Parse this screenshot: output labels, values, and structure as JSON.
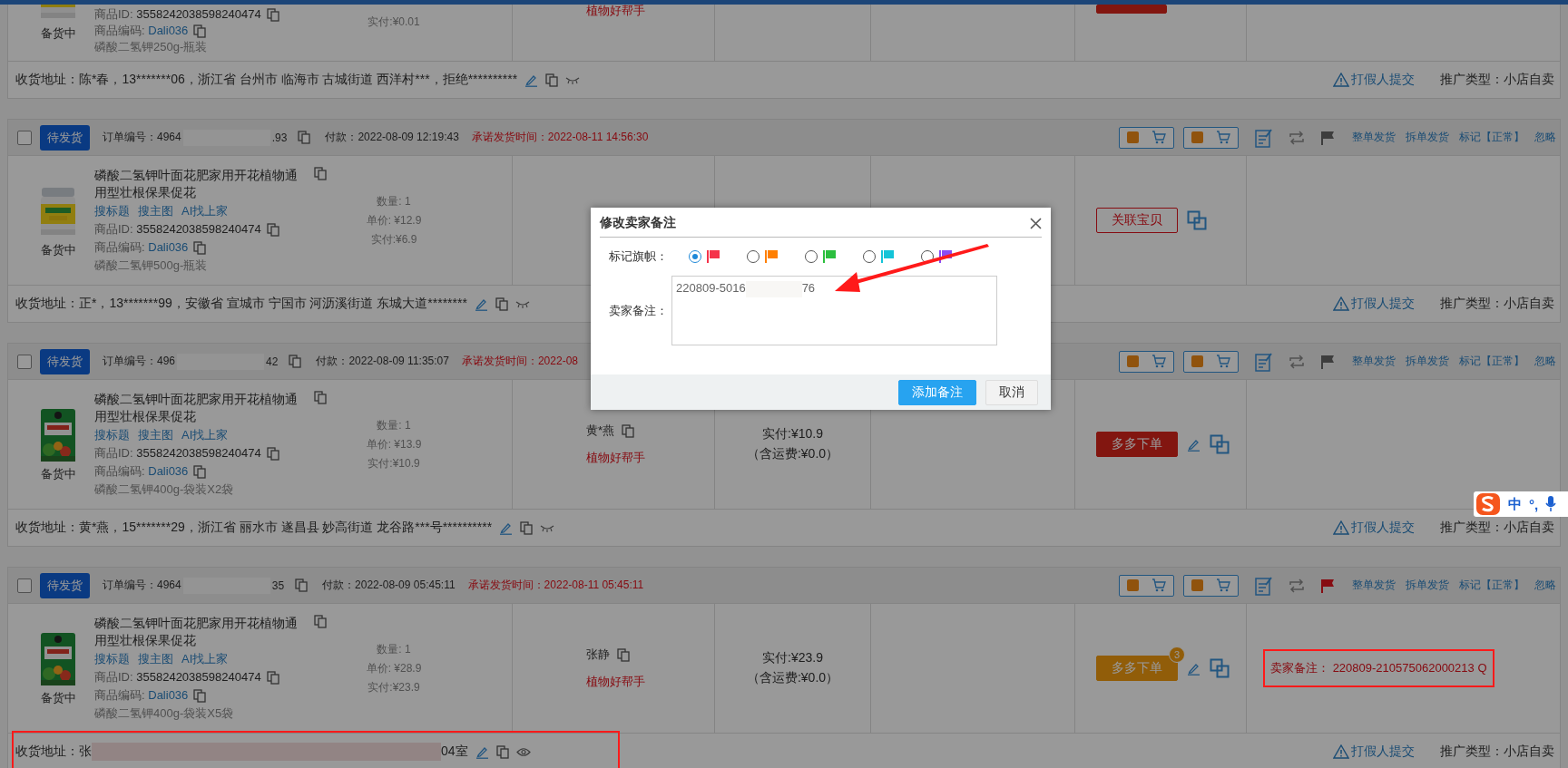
{
  "orders": [
    {
      "cut": true,
      "product": {
        "id_label": "商品ID:",
        "id": "3558242038598240474",
        "code_label": "商品编码:",
        "code": "Dali036",
        "spec": "磷酸二氢钾250g-瓶装",
        "stock": "备货中"
      },
      "qty": {
        "paid": "实付:¥0.01"
      },
      "buyer": {
        "store": "植物好帮手"
      },
      "action": {
        "kind": "red"
      },
      "address": {
        "parts": [
          "收货地址：陈*春，13*******06，浙江省 台州市 临海市 古城街道 西洋村***，拒绝**********"
        ],
        "masked": true,
        "highlight": false
      },
      "report": "打假人提交",
      "promo": "推广类型：小店自卖"
    },
    {
      "header": {
        "checked": false,
        "status": "待发货",
        "order_no": [
          "订单编号：4964",
          ".93"
        ],
        "payment": "付款：2022-08-09 12:19:43",
        "deadline": "承诺发货时间：2022-08-11 14:56:30",
        "flagged": false,
        "links": [
          "整单发货",
          "拆单发货",
          "标记【正常】",
          "忽略"
        ]
      },
      "product": {
        "title": "磷酸二氢钾叶面花肥家用开花植物通用型壮根保果促花",
        "search_links": [
          "搜标题",
          "搜主图",
          "AI找上家"
        ],
        "id_label": "商品ID:",
        "id": "3558242038598240474",
        "code_label": "商品编码:",
        "code": "Dali036",
        "spec": "磷酸二氢钾500g-瓶装",
        "stock": "备货中"
      },
      "qty": {
        "count": "数量: 1",
        "unit": "单价: ¥12.9",
        "paid": "实付:¥6.9"
      },
      "action": {
        "kind": "outline",
        "label": "关联宝贝",
        "edit": false
      },
      "address": {
        "parts": [
          "收货地址：正*，13*******99，安徽省 宣城市 宁国市 河沥溪街道 东城大道********"
        ],
        "masked": true,
        "highlight": false
      },
      "report": "打假人提交",
      "promo": "推广类型：小店自卖"
    },
    {
      "header": {
        "checked": false,
        "status": "待发货",
        "order_no": [
          "订单编号：496",
          "42"
        ],
        "payment": "付款：2022-08-09 11:35:07",
        "deadline": "承诺发货时间：2022-08",
        "flagged": false,
        "links": [
          "整单发货",
          "拆单发货",
          "标记【正常】",
          "忽略"
        ]
      },
      "product": {
        "title": "磷酸二氢钾叶面花肥家用开花植物通用型壮根保果促花",
        "search_links": [
          "搜标题",
          "搜主图",
          "AI找上家"
        ],
        "id_label": "商品ID:",
        "id": "3558242038598240474",
        "code_label": "商品编码:",
        "code": "Dali036",
        "spec": "磷酸二氢钾400g-袋装X2袋",
        "stock": "备货中"
      },
      "qty": {
        "count": "数量: 1",
        "unit": "单价: ¥13.9",
        "paid": "实付:¥10.9"
      },
      "buyer": {
        "name": "黄*燕",
        "store": "植物好帮手"
      },
      "amount": {
        "paid": "实付:¥10.9",
        "shipping": "（含运费:¥0.0）"
      },
      "action": {
        "kind": "red",
        "label": "多多下单",
        "edit": true
      },
      "address": {
        "parts": [
          "收货地址：黄*燕，15*******29，浙江省 丽水市 遂昌县 妙高街道 龙谷路***号**********"
        ],
        "masked": true,
        "highlight": false
      },
      "report": "打假人提交",
      "promo": "推广类型：小店自卖"
    },
    {
      "header": {
        "checked": false,
        "status": "待发货",
        "order_no": [
          "订单编号：4964",
          "35"
        ],
        "payment": "付款：2022-08-09 05:45:11",
        "deadline": "承诺发货时间：2022-08-11 05:45:11",
        "flagged": true,
        "links": [
          "整单发货",
          "拆单发货",
          "标记【正常】",
          "忽略"
        ]
      },
      "product": {
        "title": "磷酸二氢钾叶面花肥家用开花植物通用型壮根保果促花",
        "search_links": [
          "搜标题",
          "搜主图",
          "AI找上家"
        ],
        "id_label": "商品ID:",
        "id": "3558242038598240474",
        "code_label": "商品编码:",
        "code": "Dali036",
        "spec": "磷酸二氢钾400g-袋装X5袋",
        "stock": "备货中"
      },
      "qty": {
        "count": "数量: 1",
        "unit": "单价: ¥28.9",
        "paid": "实付:¥23.9"
      },
      "buyer": {
        "name": "张静",
        "store": "植物好帮手"
      },
      "amount": {
        "paid": "实付:¥23.9",
        "shipping": "（含运费:¥0.0）"
      },
      "action": {
        "kind": "orange",
        "label": "多多下单",
        "badge": "3",
        "edit": true
      },
      "remark": {
        "label": "卖家备注：",
        "value": "220809-210575062000213 Q",
        "highlight": true
      },
      "address": {
        "parts": [
          "收货地址：张",
          "04室"
        ],
        "masked": false,
        "highlight": true
      },
      "report": "打假人提交",
      "promo": "推广类型：小店自卖"
    }
  ],
  "modal": {
    "title": "修改卖家备注",
    "flag_label": "标记旗帜：",
    "flags": [
      {
        "color": "#f5334a",
        "selected": true
      },
      {
        "color": "#ff7f00",
        "selected": false
      },
      {
        "color": "#2cbf3f",
        "selected": false
      },
      {
        "color": "#14c4d8",
        "selected": false
      },
      {
        "color": "#8a4cf5",
        "selected": false
      }
    ],
    "remark_label": "卖家备注：",
    "remark_parts": [
      "220809-5016",
      "76"
    ],
    "arrow": true,
    "buttons": [
      {
        "label": "添加备注",
        "kind": "primary"
      },
      {
        "label": "取消",
        "kind": "default"
      }
    ]
  },
  "ime": {
    "mode": "中",
    "punct": "°,"
  }
}
